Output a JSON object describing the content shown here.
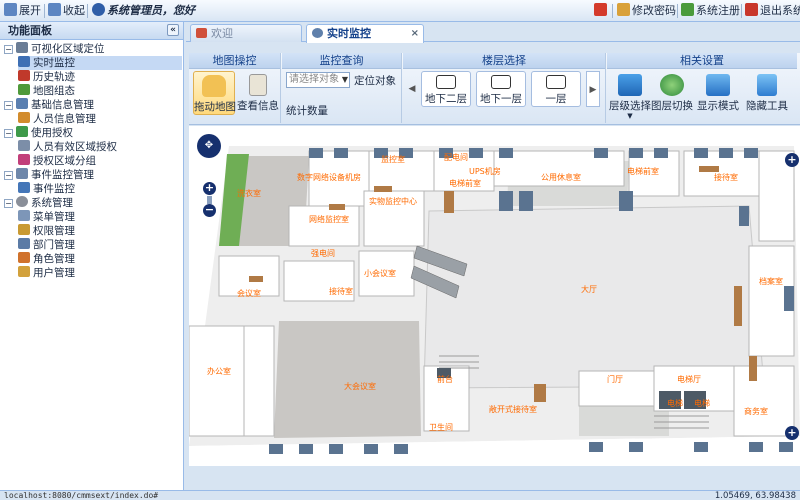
{
  "topbar": {
    "expand": "展开",
    "collapse": "收起",
    "welcome": "系统管理员，您好",
    "change_password": "修改密码",
    "register": "系统注册",
    "logout": "退出系统"
  },
  "left_panel": {
    "title": "功能面板",
    "collapse_glyph": "«",
    "tree": [
      {
        "label": "可视化区域定位"
      },
      {
        "label": "实时监控"
      },
      {
        "label": "历史轨迹"
      },
      {
        "label": "地图组态"
      },
      {
        "label": "基础信息管理"
      },
      {
        "label": "人员信息管理"
      },
      {
        "label": "使用授权"
      },
      {
        "label": "人员有效区域授权"
      },
      {
        "label": "授权区域分组"
      },
      {
        "label": "事件监控管理"
      },
      {
        "label": "事件监控"
      },
      {
        "label": "系统管理"
      },
      {
        "label": "菜单管理"
      },
      {
        "label": "权限管理"
      },
      {
        "label": "部门管理"
      },
      {
        "label": "角色管理"
      },
      {
        "label": "用户管理"
      }
    ]
  },
  "tabs": [
    {
      "label": "欢迎",
      "active": false
    },
    {
      "label": "实时监控",
      "active": true,
      "close": "×"
    }
  ],
  "ribbon": {
    "map_ops": {
      "title": "地图操控",
      "drag": "拖动地图",
      "info": "查看信息"
    },
    "monitor_query": {
      "title": "监控查询",
      "select_placeholder": "请选择对象",
      "locate": "定位对象",
      "stats": "统计数量"
    },
    "floor_select": {
      "title": "楼层选择",
      "floors": [
        "地下二层",
        "地下一层",
        "一层"
      ],
      "prev": "◀",
      "next": "▶"
    },
    "settings": {
      "title": "相关设置",
      "layer_select": "层级选择",
      "map_switch": "图层切换",
      "display_mode": "显示模式",
      "hide_tools": "隐藏工具"
    }
  },
  "map": {
    "rooms": [
      "监控室",
      "配电间",
      "UPS机房",
      "数字网络设备机房",
      "公用休息室",
      "接待室",
      "电梯前室",
      "电梯前室",
      "洗衣室",
      "实物监控中心",
      "网络监控室",
      "强电间",
      "小会议室",
      "大厅",
      "接待室",
      "会议室",
      "大会议室",
      "门厅",
      "电梯厅",
      "电梯",
      "电梯",
      "前台",
      "敞开式接待室",
      "卫生间",
      "商务室",
      "办公室",
      "档案室"
    ],
    "zoom_in": "+",
    "zoom_out": "−",
    "edge_plus": "+"
  },
  "status": {
    "url": "localhost:8080/cmmsext/index.do#",
    "coords": "1.05469, 63.98438"
  }
}
